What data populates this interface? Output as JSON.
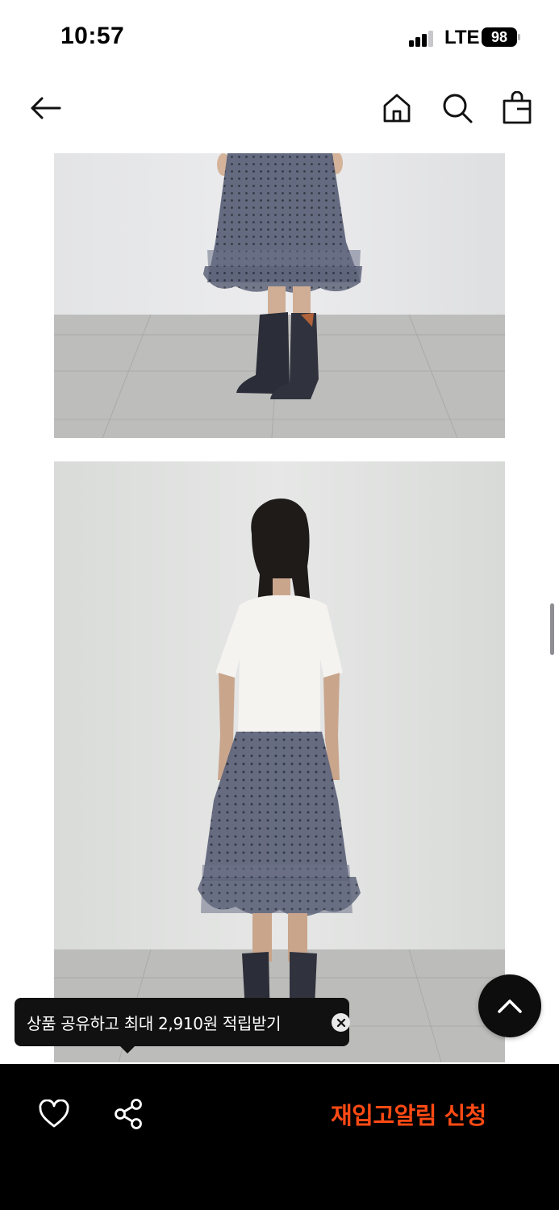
{
  "status_bar": {
    "time": "10:57",
    "network": "LTE",
    "battery": "98"
  },
  "nav": {
    "back_icon": "arrow-left-icon",
    "home_icon": "home-icon",
    "search_icon": "search-icon",
    "bag_icon": "shopping-bag-icon"
  },
  "content": {
    "images": [
      {
        "name": "product-photo-front-lower",
        "description_icon": "photo"
      },
      {
        "name": "product-photo-back",
        "description_icon": "photo"
      }
    ]
  },
  "share_tooltip": {
    "text": "상품 공유하고 최대 2,910원 적립받기",
    "close_icon": "close-icon"
  },
  "bottom_bar": {
    "like_icon": "heart-icon",
    "share_icon": "share-icon",
    "restock_label": "재입고알림 신청",
    "accent_color": "#ff4a14"
  },
  "scroll_top_icon": "chevron-up-icon"
}
